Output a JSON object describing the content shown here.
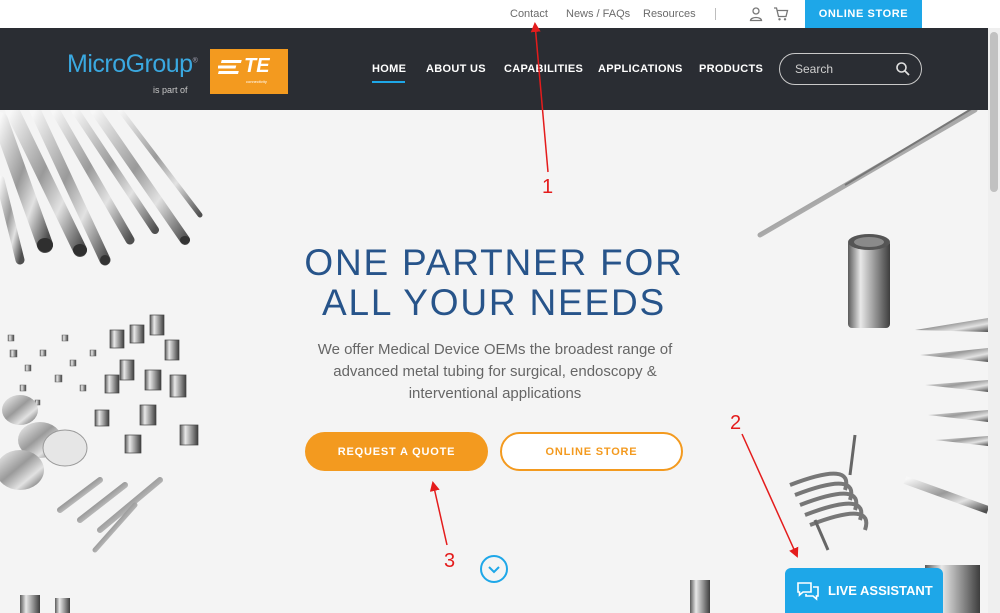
{
  "topbar": {
    "links": [
      "Contact",
      "News / FAQs",
      "Resources"
    ],
    "store_button": "ONLINE STORE",
    "icons": [
      "user-icon",
      "cart-icon"
    ]
  },
  "header": {
    "logo_text": "MicroGroup",
    "logo_sub": "is part of",
    "partner_logo": "TE",
    "partner_tagline": "connectivity",
    "nav": [
      "HOME",
      "ABOUT US",
      "CAPABILITIES",
      "APPLICATIONS",
      "PRODUCTS"
    ],
    "active_nav": "HOME",
    "search_placeholder": "Search"
  },
  "hero": {
    "headline_line1": "ONE PARTNER FOR",
    "headline_line2": "ALL YOUR NEEDS",
    "subtitle": "We offer Medical Device OEMs the broadest range of advanced metal tubing for surgical, endoscopy & interventional applications",
    "primary_button": "REQUEST A QUOTE",
    "secondary_button": "ONLINE STORE",
    "scroll_icon": "chevron-down-icon"
  },
  "chat": {
    "label": "LIVE ASSISTANT",
    "icon": "chat-icon"
  },
  "annotations": [
    "1",
    "2",
    "3"
  ],
  "colors": {
    "accent_blue": "#1ea7e8",
    "accent_orange": "#f39a1f",
    "header_bg": "#2a2d33",
    "headline": "#27548a",
    "annotation_red": "#e41c1c"
  }
}
